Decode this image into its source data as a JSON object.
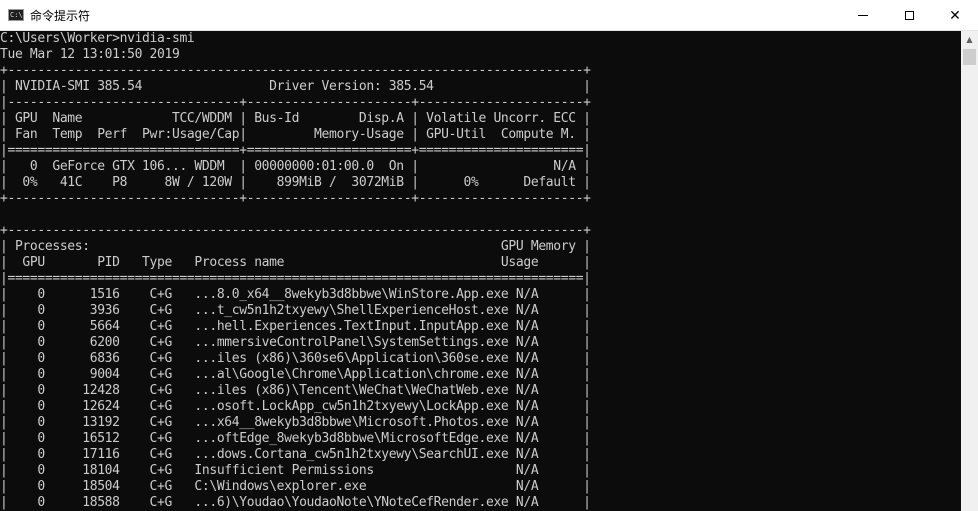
{
  "window": {
    "title": "命令提示符",
    "icon": "console-app-icon",
    "icon_glyph": "C:\\",
    "minimize": "—",
    "maximize": "☐",
    "close": "✕"
  },
  "console": {
    "lines": [
      "C:\\Users\\Worker>nvidia-smi",
      "Tue Mar 12 13:01:50 2019",
      "+-----------------------------------------------------------------------------+",
      "| NVIDIA-SMI 385.54                 Driver Version: 385.54                    |",
      "|-------------------------------+----------------------+----------------------+",
      "| GPU  Name            TCC/WDDM | Bus-Id        Disp.A | Volatile Uncorr. ECC |",
      "| Fan  Temp  Perf  Pwr:Usage/Cap|         Memory-Usage | GPU-Util  Compute M. |",
      "|===============================+======================+======================|",
      "|   0  GeForce GTX 106... WDDM  | 00000000:01:00.0  On |                  N/A |",
      "|  0%   41C    P8     8W / 120W |    899MiB /  3072MiB |      0%      Default |",
      "+-------------------------------+----------------------+----------------------+",
      "",
      "+-----------------------------------------------------------------------------+",
      "| Processes:                                                       GPU Memory |",
      "|  GPU       PID   Type   Process name                             Usage      |",
      "|=============================================================================|",
      "|    0      1516    C+G   ...8.0_x64__8wekyb3d8bbwe\\WinStore.App.exe N/A      |",
      "|    0      3936    C+G   ...t_cw5n1h2txyewy\\ShellExperienceHost.exe N/A      |",
      "|    0      5664    C+G   ...hell.Experiences.TextInput.InputApp.exe N/A      |",
      "|    0      6200    C+G   ...mmersiveControlPanel\\SystemSettings.exe N/A      |",
      "|    0      6836    C+G   ...iles (x86)\\360se6\\Application\\360se.exe N/A      |",
      "|    0      9004    C+G   ...al\\Google\\Chrome\\Application\\chrome.exe N/A      |",
      "|    0     12428    C+G   ...iles (x86)\\Tencent\\WeChat\\WeChatWeb.exe N/A      |",
      "|    0     12624    C+G   ...osoft.LockApp_cw5n1h2txyewy\\LockApp.exe N/A      |",
      "|    0     13192    C+G   ...x64__8wekyb3d8bbwe\\Microsoft.Photos.exe N/A      |",
      "|    0     16512    C+G   ...oftEdge_8wekyb3d8bbwe\\MicrosoftEdge.exe N/A      |",
      "|    0     17116    C+G   ...dows.Cortana_cw5n1h2txyewy\\SearchUI.exe N/A      |",
      "|    0     18104    C+G   Insufficient Permissions                   N/A      |",
      "|    0     18504    C+G   C:\\Windows\\explorer.exe                    N/A      |",
      "|    0     18588    C+G   ...6)\\Youdao\\YoudaoNote\\YNoteCefRender.exe N/A      |"
    ]
  },
  "scrollbar": {
    "up_arrow": "▲"
  },
  "colors": {
    "console_bg": "#0c0c0c",
    "console_fg": "#cccccc",
    "titlebar_bg": "#ffffff"
  }
}
